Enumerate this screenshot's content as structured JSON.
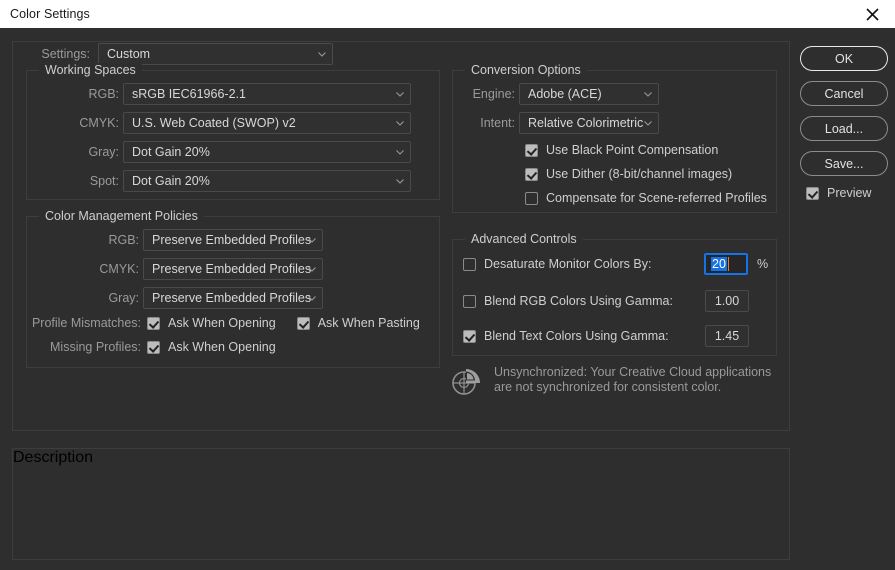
{
  "window": {
    "title": "Color Settings",
    "close_icon": "close-icon"
  },
  "settings_row": {
    "label": "Settings:",
    "value": "Custom"
  },
  "working_spaces": {
    "legend": "Working Spaces",
    "fields": [
      {
        "label": "RGB:",
        "value": "sRGB IEC61966-2.1"
      },
      {
        "label": "CMYK:",
        "value": "U.S. Web Coated (SWOP) v2"
      },
      {
        "label": "Gray:",
        "value": "Dot Gain 20%"
      },
      {
        "label": "Spot:",
        "value": "Dot Gain 20%"
      }
    ]
  },
  "color_management_policies": {
    "legend": "Color Management Policies",
    "fields": [
      {
        "label": "RGB:",
        "value": "Preserve Embedded Profiles"
      },
      {
        "label": "CMYK:",
        "value": "Preserve Embedded Profiles"
      },
      {
        "label": "Gray:",
        "value": "Preserve Embedded Profiles"
      }
    ],
    "profile_mismatches": {
      "label": "Profile Mismatches:",
      "ask_when_opening": {
        "label": "Ask When Opening",
        "checked": true
      },
      "ask_when_pasting": {
        "label": "Ask When Pasting",
        "checked": true
      }
    },
    "missing_profiles": {
      "label": "Missing Profiles:",
      "ask_when_opening": {
        "label": "Ask When Opening",
        "checked": true
      }
    }
  },
  "conversion_options": {
    "legend": "Conversion Options",
    "engine": {
      "label": "Engine:",
      "value": "Adobe (ACE)"
    },
    "intent": {
      "label": "Intent:",
      "value": "Relative Colorimetric"
    },
    "checkboxes": [
      {
        "label": "Use Black Point Compensation",
        "checked": true
      },
      {
        "label": "Use Dither (8-bit/channel images)",
        "checked": true
      },
      {
        "label": "Compensate for Scene-referred Profiles",
        "checked": false
      }
    ]
  },
  "advanced_controls": {
    "legend": "Advanced Controls",
    "rows": [
      {
        "label": "Desaturate Monitor Colors By:",
        "checked": false,
        "value": "20",
        "suffix": "%"
      },
      {
        "label": "Blend RGB Colors Using Gamma:",
        "checked": false,
        "value": "1.00",
        "suffix": ""
      },
      {
        "label": "Blend Text Colors Using Gamma:",
        "checked": true,
        "value": "1.45",
        "suffix": ""
      }
    ]
  },
  "sync_notice": {
    "icon": "color-wheel-sync-icon",
    "line1": "Unsynchronized: Your Creative Cloud applications",
    "line2": "are not synchronized for consistent color."
  },
  "buttons": {
    "ok": "OK",
    "cancel": "Cancel",
    "load": "Load...",
    "save": "Save...",
    "preview": {
      "label": "Preview",
      "checked": true
    }
  },
  "description": {
    "legend": "Description",
    "body": ""
  },
  "colors": {
    "accent_blue": "#1473e6",
    "dialog_bg": "#2e2e2e",
    "titlebar_bg": "#ffffff",
    "caret": "#e07b39"
  }
}
